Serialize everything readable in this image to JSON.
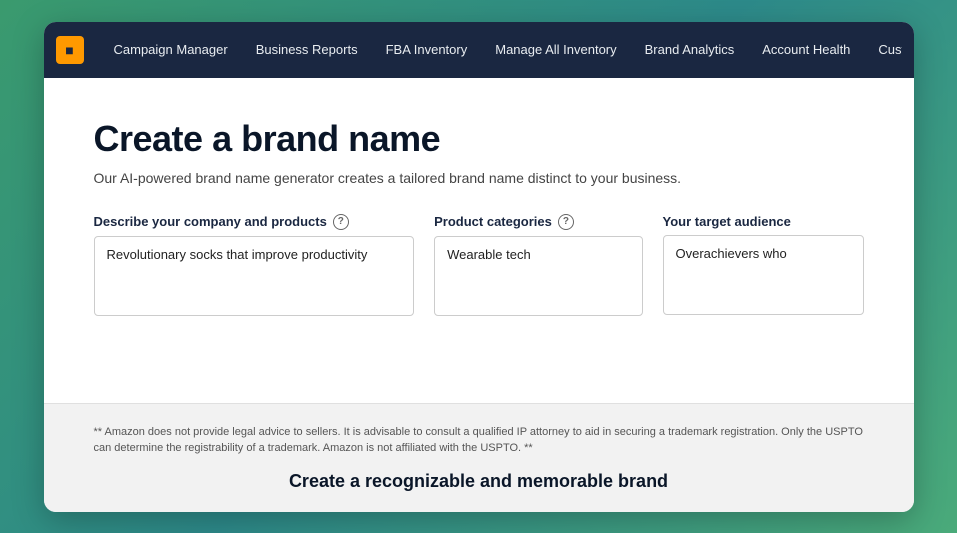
{
  "nav": {
    "logo_text": "■",
    "items": [
      {
        "label": "Campaign Manager"
      },
      {
        "label": "Business Reports"
      },
      {
        "label": "FBA Inventory"
      },
      {
        "label": "Manage All Inventory"
      },
      {
        "label": "Brand Analytics"
      },
      {
        "label": "Account Health"
      },
      {
        "label": "Custom"
      }
    ]
  },
  "page": {
    "title": "Create a brand name",
    "subtitle": "Our AI-powered brand name generator creates a tailored brand name distinct to your business.",
    "fields": [
      {
        "label": "Describe your company and products",
        "has_help": true,
        "value": "Revolutionary socks that improve productivity",
        "placeholder": "Revolutionary socks that improve productivity",
        "size": "large"
      },
      {
        "label": "Product categories",
        "has_help": true,
        "value": "Wearable tech",
        "placeholder": "Wearable tech",
        "size": "medium"
      },
      {
        "label": "Your target audience",
        "has_help": false,
        "value": "Overachievers who",
        "placeholder": "Overachievers who",
        "size": "small"
      }
    ]
  },
  "footer": {
    "disclaimer": "** Amazon does not provide legal advice to sellers. It is advisable to consult a qualified IP attorney to aid in securing a trademark registration. Only the USPTO can determine the registrability of a trademark. Amazon is not affiliated with the USPTO. **",
    "cta": "Create a recognizable and memorable brand"
  }
}
